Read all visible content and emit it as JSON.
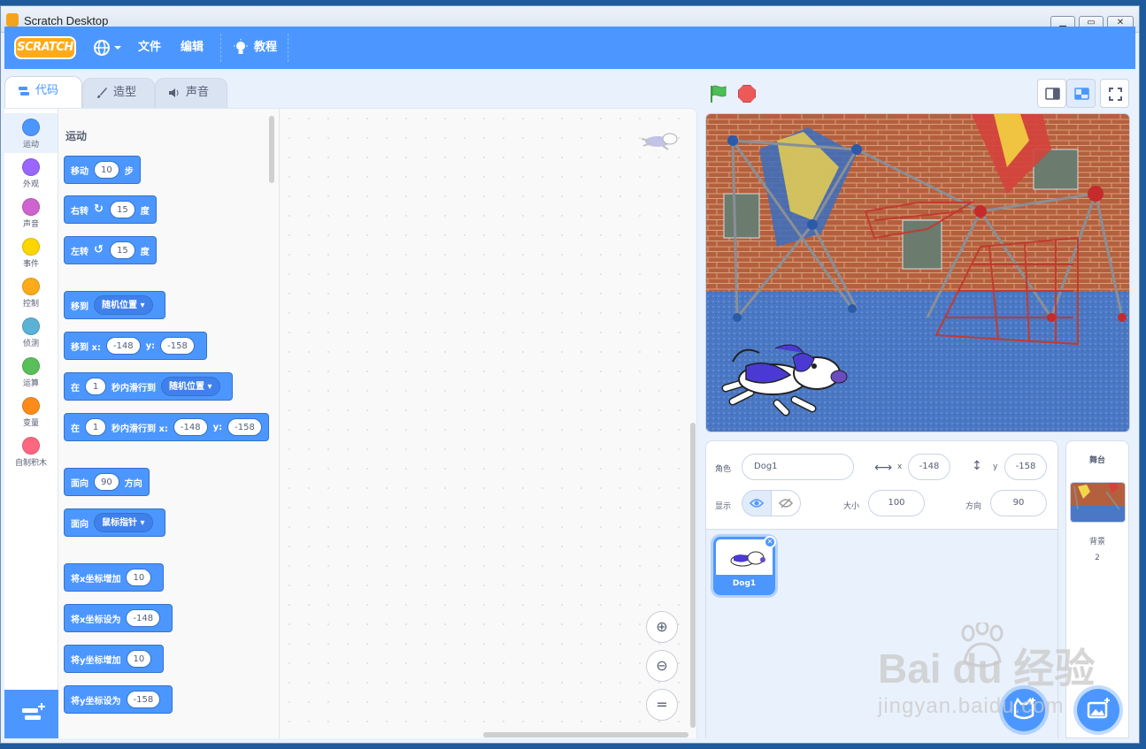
{
  "window": {
    "title": "Scratch Desktop"
  },
  "menu": {
    "file": "文件",
    "edit": "编辑",
    "tutorials": "教程",
    "logo_text": "SCRATCH"
  },
  "tabs": {
    "code": "代码",
    "costumes": "造型",
    "sounds": "声音"
  },
  "categories": [
    {
      "label": "运动",
      "color": "#4c97ff"
    },
    {
      "label": "外观",
      "color": "#9966ff"
    },
    {
      "label": "声音",
      "color": "#cf63cf"
    },
    {
      "label": "事件",
      "color": "#ffd500"
    },
    {
      "label": "控制",
      "color": "#ffab19"
    },
    {
      "label": "侦测",
      "color": "#5cb1d6"
    },
    {
      "label": "运算",
      "color": "#59c059"
    },
    {
      "label": "变量",
      "color": "#ff8c1a"
    },
    {
      "label": "自制积木",
      "color": "#ff6680"
    }
  ],
  "palette": {
    "section": "运动",
    "move": {
      "w1": "移动",
      "v": "10",
      "w2": "步"
    },
    "turn_right": {
      "w1": "右转",
      "v": "15",
      "w2": "度"
    },
    "turn_left": {
      "w1": "左转",
      "v": "15",
      "w2": "度"
    },
    "goto": {
      "w1": "移到",
      "dd": "随机位置"
    },
    "goto_xy": {
      "w1": "移到 x:",
      "x": "-148",
      "w2": "y:",
      "y": "-158"
    },
    "glide": {
      "w1": "在",
      "v": "1",
      "w2": "秒内滑行到",
      "dd": "随机位置"
    },
    "glide_xy": {
      "w1": "在",
      "v": "1",
      "w2": "秒内滑行到 x:",
      "x": "-148",
      "w3": "y:",
      "y": "-158"
    },
    "point_dir": {
      "w1": "面向",
      "v": "90",
      "w2": "方向"
    },
    "point_towards": {
      "w1": "面向",
      "dd": "鼠标指针"
    },
    "change_x": {
      "w1": "将x坐标增加",
      "v": "10"
    },
    "set_x": {
      "w1": "将x坐标设为",
      "v": "-148"
    },
    "change_y": {
      "w1": "将y坐标增加",
      "v": "10"
    },
    "set_y": {
      "w1": "将y坐标设为",
      "v": "-158"
    }
  },
  "sprite_info": {
    "sprite_label": "角色",
    "sprite_name": "Dog1",
    "x_label": "x",
    "x": "-148",
    "y_label": "y",
    "y": "-158",
    "show_label": "显示",
    "size_label": "大小",
    "size": "100",
    "direction_label": "方向",
    "direction": "90"
  },
  "sprites": [
    {
      "name": "Dog1"
    }
  ],
  "stage_panel": {
    "title": "舞台",
    "backdrop_label": "背景",
    "backdrop_count": "2"
  },
  "watermark": {
    "line1": "Bai du 经验",
    "line2": "jingyan.baidu.com"
  }
}
